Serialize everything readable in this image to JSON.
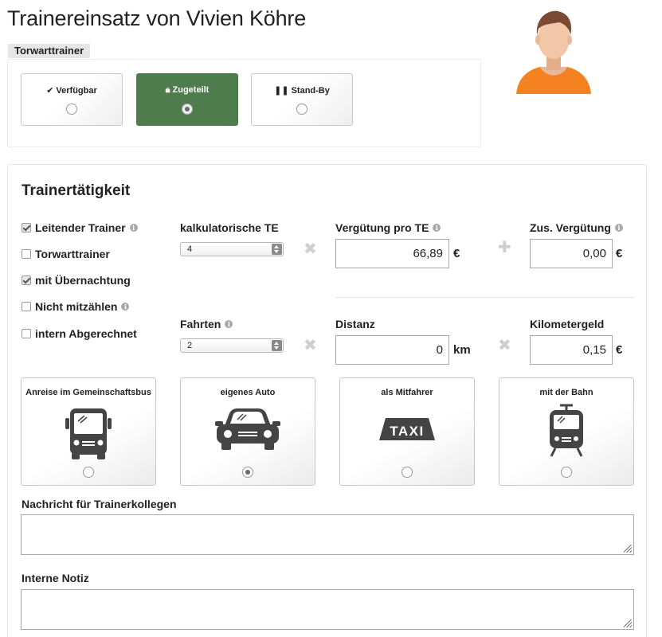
{
  "header": {
    "title": "Trainereinsatz von Vivien Köhre"
  },
  "role": {
    "tag": "Torwarttrainer"
  },
  "status": {
    "options": [
      {
        "icon": "check-icon",
        "glyph": "✔",
        "label": "Verfügbar",
        "selected": false
      },
      {
        "icon": "lock-icon",
        "glyph": "🔒",
        "label": "Zugeteilt",
        "selected": true
      },
      {
        "icon": "pause-icon",
        "glyph": "❚❚",
        "label": "Stand-By",
        "selected": false
      }
    ],
    "active_color": "#4e7c4d"
  },
  "avatar": {
    "icon": "person-avatar-icon",
    "shirt_color": "#f58220"
  },
  "activity": {
    "title": "Trainertätigkeit",
    "checkboxes": [
      {
        "label": "Leitender Trainer",
        "checked": true,
        "info": true
      },
      {
        "label": "Torwarttrainer",
        "checked": false,
        "info": false
      },
      {
        "label": "mit Übernachtung",
        "checked": true,
        "info": false
      },
      {
        "label": "Nicht mitzählen",
        "checked": false,
        "info": true
      },
      {
        "label": "intern Abgerechnet",
        "checked": false,
        "info": false
      }
    ],
    "te": {
      "label": "kalkulatorische TE",
      "value": "4",
      "multiply": "✖",
      "rate_label": "Vergütung pro TE",
      "rate_value": "66,89",
      "rate_unit": "€",
      "plus": "✚",
      "extra_label": "Zus. Vergütung",
      "extra_value": "0,00",
      "extra_unit": "€"
    },
    "trips": {
      "label": "Fahrten",
      "value": "2",
      "multiply1": "✖",
      "distance_label": "Distanz",
      "distance_value": "0",
      "distance_unit": "km",
      "multiply2": "✖",
      "km_label": "Kilometergeld",
      "km_value": "0,15",
      "km_unit": "€"
    }
  },
  "travel": {
    "options": [
      {
        "label": "Anreise im Gemeinschaftsbus",
        "icon": "bus-icon",
        "selected": false
      },
      {
        "label": "eigenes Auto",
        "icon": "car-icon",
        "selected": true
      },
      {
        "label": "als Mitfahrer",
        "icon": "taxi-icon",
        "selected": false,
        "sign": "TAXI"
      },
      {
        "label": "mit der Bahn",
        "icon": "tram-icon",
        "selected": false
      }
    ],
    "icon_color": "#444444"
  },
  "notes": {
    "colleague_label": "Nachricht für Trainerkollegen",
    "colleague_value": "",
    "internal_label": "Interne Notiz",
    "internal_value": ""
  }
}
